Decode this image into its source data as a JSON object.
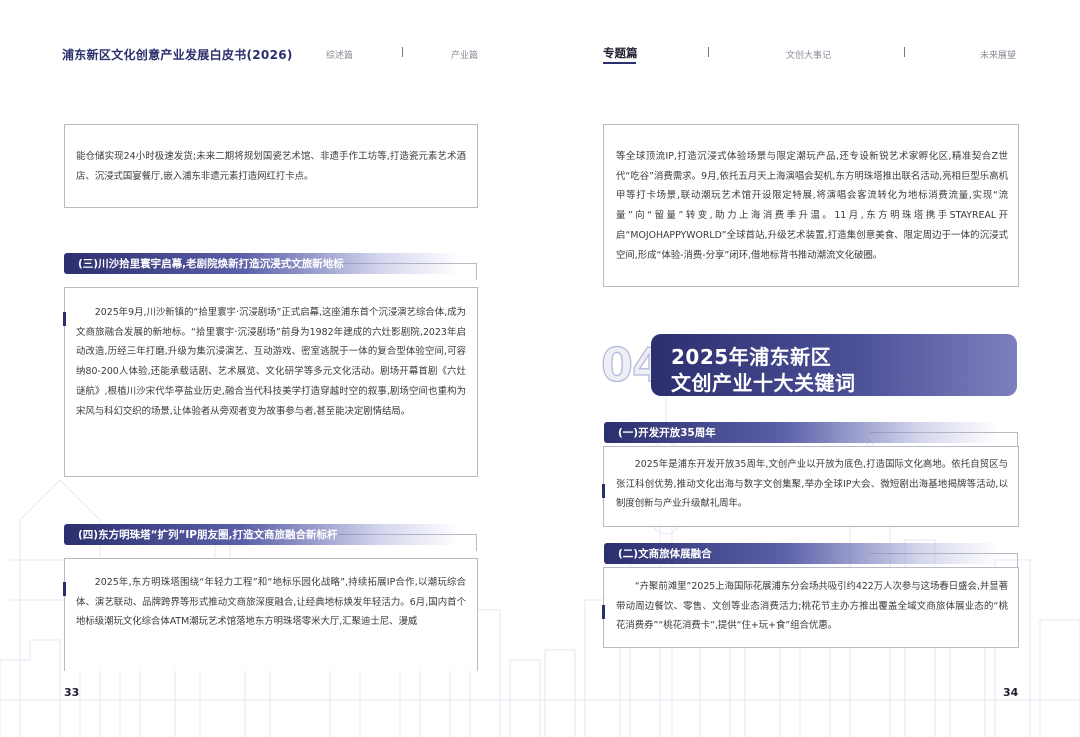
{
  "header": {
    "title": "浦东新区文化创意产业发展白皮书(2026)",
    "nav": [
      "综述篇",
      "产业篇",
      "专题篇",
      "文创大事记",
      "未来展望"
    ],
    "active_nav": "专题篇"
  },
  "left_page": {
    "continued_text": "能仓储实现24小时极速发货;未来二期将规划国瓷艺术馆、非遗手作工坊等,打造瓷元素艺术酒店、沉浸式国宴餐厅,嵌入浦东非遗元素打造网红打卡点。",
    "section3": {
      "heading": "(三)川沙拾里寰宇启幕,老剧院焕新打造沉浸式文旅新地标",
      "body": "2025年9月,川沙新镇的“拾里寰宇·沉浸剧场”正式启幕,这座浦东首个沉浸演艺综合体,成为文商旅融合发展的新地标。“拾里寰宇·沉浸剧场”前身为1982年建成的六灶影剧院,2023年启动改造,历经三年打磨,升级为集沉浸演艺、互动游戏、密室逃脱于一体的复合型体验空间,可容纳80-200人体验,还能承载话剧、艺术展览、文化研学等多元文化活动。剧场开幕首剧《六灶谜航》,根植川沙宋代华亭盐业历史,融合当代科技美学打造穿越时空的叙事,剧场空间也重构为宋风与科幻交织的场景,让体验者从旁观者变为故事参与者,甚至能决定剧情结局。"
    },
    "section4": {
      "heading": "(四)东方明珠塔“扩列”IP朋友圈,打造文商旅融合新标杆",
      "body": "2025年,东方明珠塔围绕“年轻力工程”和“地标乐园化战略”,持续拓展IP合作,以潮玩综合体、演艺联动、品牌跨界等形式推动文商旅深度融合,让经典地标焕发年轻活力。6月,国内首个地标级潮玩文化综合体ATM潮玩艺术馆落地东方明珠塔零米大厅,汇聚迪士尼、漫威"
    },
    "page_number": "33"
  },
  "right_page": {
    "continued_text": "等全球顶流IP,打造沉浸式体验场景与限定潮玩产品,还专设新锐艺术家孵化区,精准契合Z世代“吃谷”消费需求。9月,依托五月天上海演唱会契机,东方明珠塔推出联名活动,亮相巨型乐高机甲等打卡场景,联动潮玩艺术馆开设限定特展,将演唱会客流转化为地标消费流量,实现“流量”向“留量”转变,助力上海消费季升温。11月,东方明珠塔携手STAYREAL开启“MOJOHAPPYWORLD”全球首站,升级艺术装置,打造集创意美食、限定周边于一体的沉浸式空间,形成“体验-消费-分享”闭环,借地标背书推动潮流文化破圈。",
    "chapter": {
      "number": "04",
      "title_line1": "2025年浦东新区",
      "title_line2": "文创产业十大关键词"
    },
    "kw1": {
      "heading": "(一)开发开放35周年",
      "body": "2025年是浦东开发开放35周年,文创产业以开放为底色,打造国际文化高地。依托自贸区与张江科创优势,推动文化出海与数字文创集聚,举办全球IP大会、微短剧出海基地揭牌等活动,以制度创新与产业升级献礼周年。"
    },
    "kw2": {
      "heading": "(二)文商旅体展融合",
      "body": "“卉聚前滩里”2025上海国际花展浦东分会场共吸引约422万人次参与这场春日盛会,并显著带动周边餐饮、零售、文创等业态消费活力;桃花节主办方推出覆盖全域文商旅体展业态的“桃花消费券”“桃花消费卡”,提供“住+玩+食”组合优惠。"
    },
    "page_number": "34"
  },
  "colors": {
    "primary": "#2c2f6e",
    "border": "#b9b9c6",
    "text": "#3a3a3a"
  }
}
